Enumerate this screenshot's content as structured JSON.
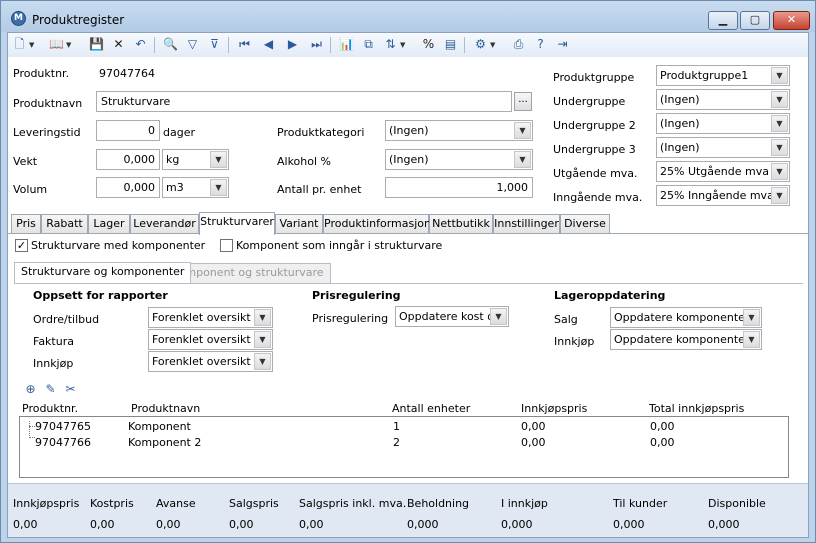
{
  "window": {
    "title": "Produktregister",
    "app_icon_letter": "M"
  },
  "form": {
    "produktnr": {
      "label": "Produktnr.",
      "value": "97047764"
    },
    "produktnavn": {
      "label": "Produktnavn",
      "value": "Strukturvare",
      "button": "..."
    },
    "leveringstid": {
      "label": "Leveringstid",
      "value": "0",
      "unit": "dager"
    },
    "vekt": {
      "label": "Vekt",
      "value": "0,000",
      "unit": "kg"
    },
    "volum": {
      "label": "Volum",
      "value": "0,000",
      "unit": "m3"
    },
    "produktkategori": {
      "label": "Produktkategori",
      "value": "(Ingen)"
    },
    "alkohol": {
      "label": "Alkohol %",
      "value": "(Ingen)"
    },
    "antall": {
      "label": "Antall pr. enhet",
      "value": "1,000"
    },
    "produktgruppe": {
      "label": "Produktgruppe",
      "value": "Produktgruppe1"
    },
    "undergruppe": {
      "label": "Undergruppe",
      "value": "(Ingen)"
    },
    "undergruppe2": {
      "label": "Undergruppe 2",
      "value": "(Ingen)"
    },
    "undergruppe3": {
      "label": "Undergruppe 3",
      "value": "(Ingen)"
    },
    "utgaende": {
      "label": "Utgående mva.",
      "value": "25% Utgående mva"
    },
    "inngaende": {
      "label": "Inngående mva.",
      "value": "25% Inngående mva"
    }
  },
  "tabs": [
    "Pris",
    "Rabatt",
    "Lager",
    "Leverandør",
    "Strukturvarer",
    "Variant",
    "Produktinformasjon",
    "Nettbutikk",
    "Innstillinger",
    "Diverse"
  ],
  "struktur": {
    "chk_struktur": {
      "label": "Strukturvare med komponenter",
      "checked": "✓"
    },
    "chk_komponent": {
      "label": "Komponent som inngår i strukturvare",
      "checked": ""
    },
    "subtabs": [
      "Strukturvare og komponenter",
      "Komponent og strukturvare"
    ],
    "oppsett": {
      "title": "Oppsett for rapporter",
      "ordre": {
        "label": "Ordre/tilbud",
        "value": "Forenklet oversikt"
      },
      "faktura": {
        "label": "Faktura",
        "value": "Forenklet oversikt"
      },
      "innkjop": {
        "label": "Innkjøp",
        "value": "Forenklet oversikt"
      }
    },
    "prisregulering": {
      "title": "Prisregulering",
      "label": "Prisregulering",
      "value": "Oppdatere kost og"
    },
    "lager": {
      "title": "Lageroppdatering",
      "salg": {
        "label": "Salg",
        "value": "Oppdatere komponentene"
      },
      "innkjop": {
        "label": "Innkjøp",
        "value": "Oppdatere komponentene"
      }
    },
    "columns": [
      "Produktnr.",
      "Produktnavn",
      "Antall enheter",
      "Innkjøpspris",
      "Total innkjøpspris"
    ],
    "rows": [
      {
        "nr": "97047765",
        "navn": "Komponent",
        "antall": "1",
        "innkjop": "0,00",
        "total": "0,00"
      },
      {
        "nr": "97047766",
        "navn": "Komponent 2",
        "antall": "2",
        "innkjop": "0,00",
        "total": "0,00"
      }
    ]
  },
  "footer": [
    {
      "label": "Innkjøpspris",
      "value": "0,00"
    },
    {
      "label": "Kostpris",
      "value": "0,00"
    },
    {
      "label": "Avanse",
      "value": "0,00"
    },
    {
      "label": "Salgspris",
      "value": "0,00"
    },
    {
      "label": "Salgspris inkl. mva.",
      "value": "0,00"
    },
    {
      "label": "Beholdning",
      "value": "0,000"
    },
    {
      "label": "I innkjøp",
      "value": "0,000"
    },
    {
      "label": "Til kunder",
      "value": "0,000"
    },
    {
      "label": "Disponible",
      "value": "0,000"
    }
  ]
}
